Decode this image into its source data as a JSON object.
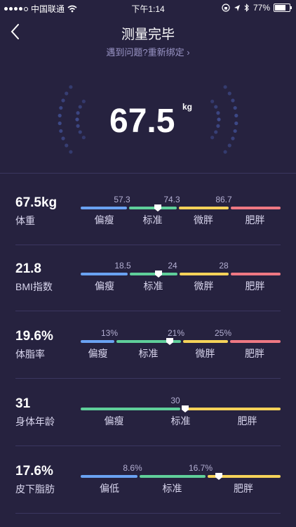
{
  "status_bar": {
    "carrier": "中国联通",
    "time": "下午1:14",
    "battery": "77%",
    "battery_level": 0.77
  },
  "header": {
    "title": "测量完毕",
    "subtitle": "遇到问题?重新绑定 ›"
  },
  "hero": {
    "weight": "67.5",
    "unit": "kg"
  },
  "colors": {
    "blue": "#6aa2f2",
    "green": "#5fcf9a",
    "yellow": "#f5d259",
    "red": "#ef7883",
    "bg": "#26223f"
  },
  "metrics": [
    {
      "value": "67.5kg",
      "label": "体重",
      "thresholds": [
        "57.3",
        "74.3",
        "86.7"
      ],
      "categories": [
        "偏瘦",
        "标准",
        "微胖",
        "肥胖"
      ],
      "current": 67.5
    },
    {
      "value": "21.8",
      "label": "BMI指数",
      "thresholds": [
        "18.5",
        "24",
        "28"
      ],
      "categories": [
        "偏瘦",
        "标准",
        "微胖",
        "肥胖"
      ],
      "current": 21.8
    },
    {
      "value": "19.6%",
      "label": "体脂率",
      "thresholds": [
        "13%",
        "21%",
        "25%"
      ],
      "categories": [
        "偏瘦",
        "标准",
        "微胖",
        "肥胖"
      ],
      "current": 19.6
    },
    {
      "value": "31",
      "label": "身体年龄",
      "thresholds": [
        "30"
      ],
      "categories": [
        "偏瘦",
        "标准",
        "肥胖"
      ],
      "current": 31
    },
    {
      "value": "17.6%",
      "label": "皮下脂肪",
      "thresholds": [
        "8.6%",
        "16.7%"
      ],
      "categories": [
        "偏低",
        "标准",
        "肥胖"
      ],
      "current": 17.6
    }
  ]
}
